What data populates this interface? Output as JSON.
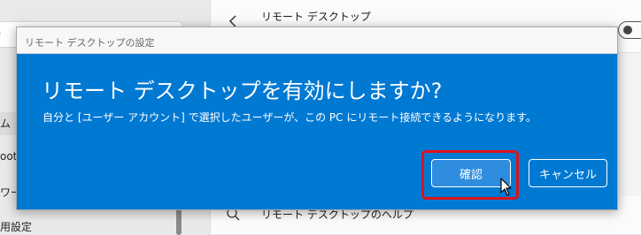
{
  "background": {
    "search_fragment": "索",
    "left_fragments": [
      "ム",
      "oot",
      "ワー",
      "用設定"
    ],
    "card_title": "リモート デスクトップ",
    "help_link": "リモート デスクトップのヘルプ"
  },
  "dialog": {
    "window_title": "リモート デスクトップの設定",
    "heading": "リモート デスクトップを有効にしますか?",
    "description": "自分と [ユーザー アカウント] で選択したユーザーが、この PC にリモート接続できるようになります。",
    "confirm_label": "確認",
    "cancel_label": "キャンセル"
  },
  "colors": {
    "dialog_blue": "#0079d3",
    "highlight_red": "#e0111a"
  },
  "icons": {
    "cursor": "mouse-pointer-icon",
    "help": "help-search-icon",
    "chevron": "chevron-left-icon"
  }
}
